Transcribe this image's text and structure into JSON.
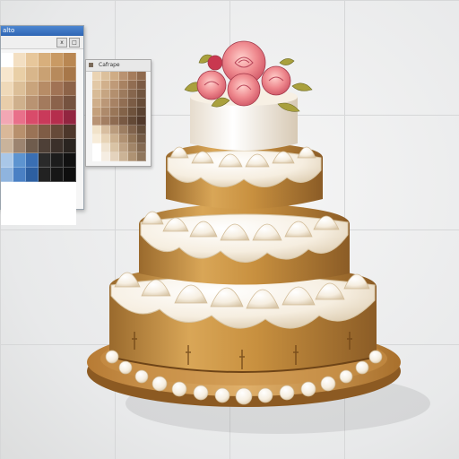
{
  "panel1": {
    "title": "alto",
    "swatches": [
      "#ffffff",
      "#f3dfc2",
      "#e7c79b",
      "#d8af7c",
      "#c99a64",
      "#b98752",
      "#f7e6cd",
      "#e9cfa6",
      "#d8b68b",
      "#c9a173",
      "#b78a5c",
      "#a77749",
      "#efd9b9",
      "#dcbf98",
      "#c9a47c",
      "#b78c66",
      "#a17355",
      "#8d6348",
      "#e8cdaa",
      "#cfb08c",
      "#b99372",
      "#a37a5d",
      "#8b624b",
      "#75523f",
      "#f2a7b4",
      "#e9708a",
      "#d94b6a",
      "#c93a5a",
      "#b52e4d",
      "#922540",
      "#d9b899",
      "#b8906d",
      "#9a7356",
      "#7f5c45",
      "#664a39",
      "#4d372b",
      "#c9b39b",
      "#9c8470",
      "#6f5c4d",
      "#4e4037",
      "#3b302a",
      "#2a2420",
      "#a9c7e8",
      "#5d94d0",
      "#3a6fb3",
      "#2a2a2a",
      "#1c1c1c",
      "#111111",
      "#8fb4de",
      "#4a80c4",
      "#2d5fa0",
      "#222222",
      "#161616",
      "#0e0e0e",
      "#ffffff",
      "#ffffff",
      "#ffffff",
      "#ffffff",
      "#ffffff",
      "#ffffff",
      "#ffffff",
      "#ffffff",
      "#ffffff",
      "#ffffff",
      "#ffffff",
      "#ffffff",
      "#ffffff",
      "#ffffff",
      "#ffffff",
      "#ffffff",
      "#ffffff",
      "#ffffff"
    ]
  },
  "panel2": {
    "title": "Cafrape",
    "swatches": [
      "#ead3b3",
      "#dcc09c",
      "#cfac85",
      "#b99271",
      "#a57c5c",
      "#8f6a4e",
      "#e2c8a6",
      "#d1b08c",
      "#bf9a78",
      "#a88262",
      "#916d52",
      "#7c5b44",
      "#d8bb97",
      "#c6a582",
      "#b38f6e",
      "#9c7a5d",
      "#86664d",
      "#71553f",
      "#cfae8a",
      "#bb9777",
      "#a78264",
      "#916e53",
      "#7b5c45",
      "#674c38",
      "#c4a07c",
      "#ae8a6b",
      "#997658",
      "#836349",
      "#6e523c",
      "#5a4231",
      "#b89374",
      "#a37e62",
      "#8e6b51",
      "#785943",
      "#634936",
      "#51392b",
      "#f1e2c9",
      "#d8bea0",
      "#ba9c7d",
      "#9d7e62",
      "#80634c",
      "#644d3a",
      "#f7ecd9",
      "#e7d3b6",
      "#cdb291",
      "#b09172",
      "#917457",
      "#735a45",
      "#ffffff",
      "#f0e4d2",
      "#d9c3a5",
      "#bfa385",
      "#a18568",
      "#846a52",
      "#ffffff",
      "#f5ede2",
      "#e4d3bd",
      "#cbb396",
      "#ae9273",
      "#8f765c"
    ]
  },
  "icons": {
    "tool_a": "x",
    "tool_b": "□"
  }
}
